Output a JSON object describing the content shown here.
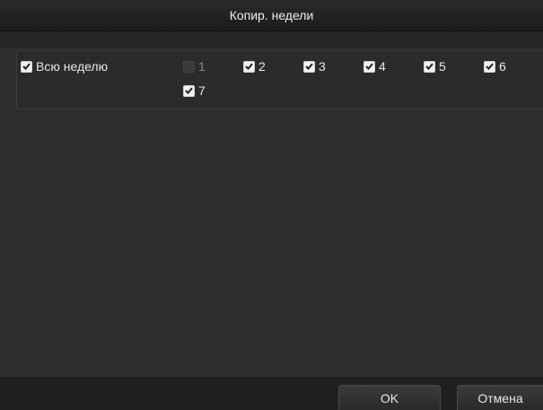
{
  "dialog": {
    "title": "Копир. недели"
  },
  "week": {
    "all_label": "Всю неделю",
    "all_checked": true,
    "days": [
      {
        "label": "1",
        "checked": false,
        "disabled": true
      },
      {
        "label": "2",
        "checked": true,
        "disabled": false
      },
      {
        "label": "3",
        "checked": true,
        "disabled": false
      },
      {
        "label": "4",
        "checked": true,
        "disabled": false
      },
      {
        "label": "5",
        "checked": true,
        "disabled": false
      },
      {
        "label": "6",
        "checked": true,
        "disabled": false
      },
      {
        "label": "7",
        "checked": true,
        "disabled": false
      }
    ]
  },
  "buttons": {
    "ok_label": "OK",
    "cancel_label": "Отмена"
  },
  "colors": {
    "background": "#2d2d2d",
    "titlebar": "#1c1c1c",
    "checkbox_checked": "#f0f0f0",
    "checkbox_unchecked": "#3a3a3a",
    "text": "#e8e8e8"
  },
  "icons": {
    "check": "check-icon"
  }
}
